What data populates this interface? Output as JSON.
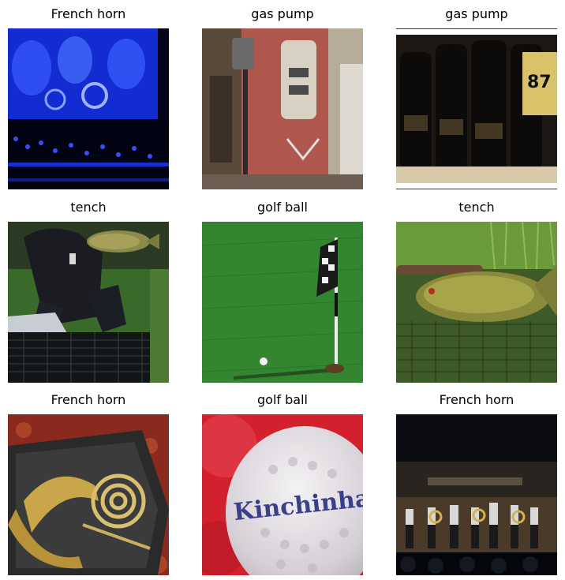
{
  "grid": {
    "items": [
      {
        "label": "French horn",
        "scene": "orchestra-screen"
      },
      {
        "label": "gas pump",
        "scene": "vintage-gas-pump"
      },
      {
        "label": "gas pump",
        "scene": "pump-nozzles-closeup"
      },
      {
        "label": "tench",
        "scene": "person-holding-fish"
      },
      {
        "label": "golf ball",
        "scene": "putting-green-flag"
      },
      {
        "label": "tench",
        "scene": "fish-on-net"
      },
      {
        "label": "French horn",
        "scene": "horn-in-case"
      },
      {
        "label": "golf ball",
        "scene": "golf-ball-closeup"
      },
      {
        "label": "French horn",
        "scene": "band-on-stage"
      }
    ]
  },
  "images": {
    "ball_imprint": "Kinchinha",
    "pump_number": "87"
  },
  "colors": {
    "stage_blue": "#1a3cff",
    "pump_red": "#a8342c",
    "grass_green": "#2e7a2a",
    "ball_red": "#d2202c",
    "rug_red": "#8a2a1e"
  }
}
